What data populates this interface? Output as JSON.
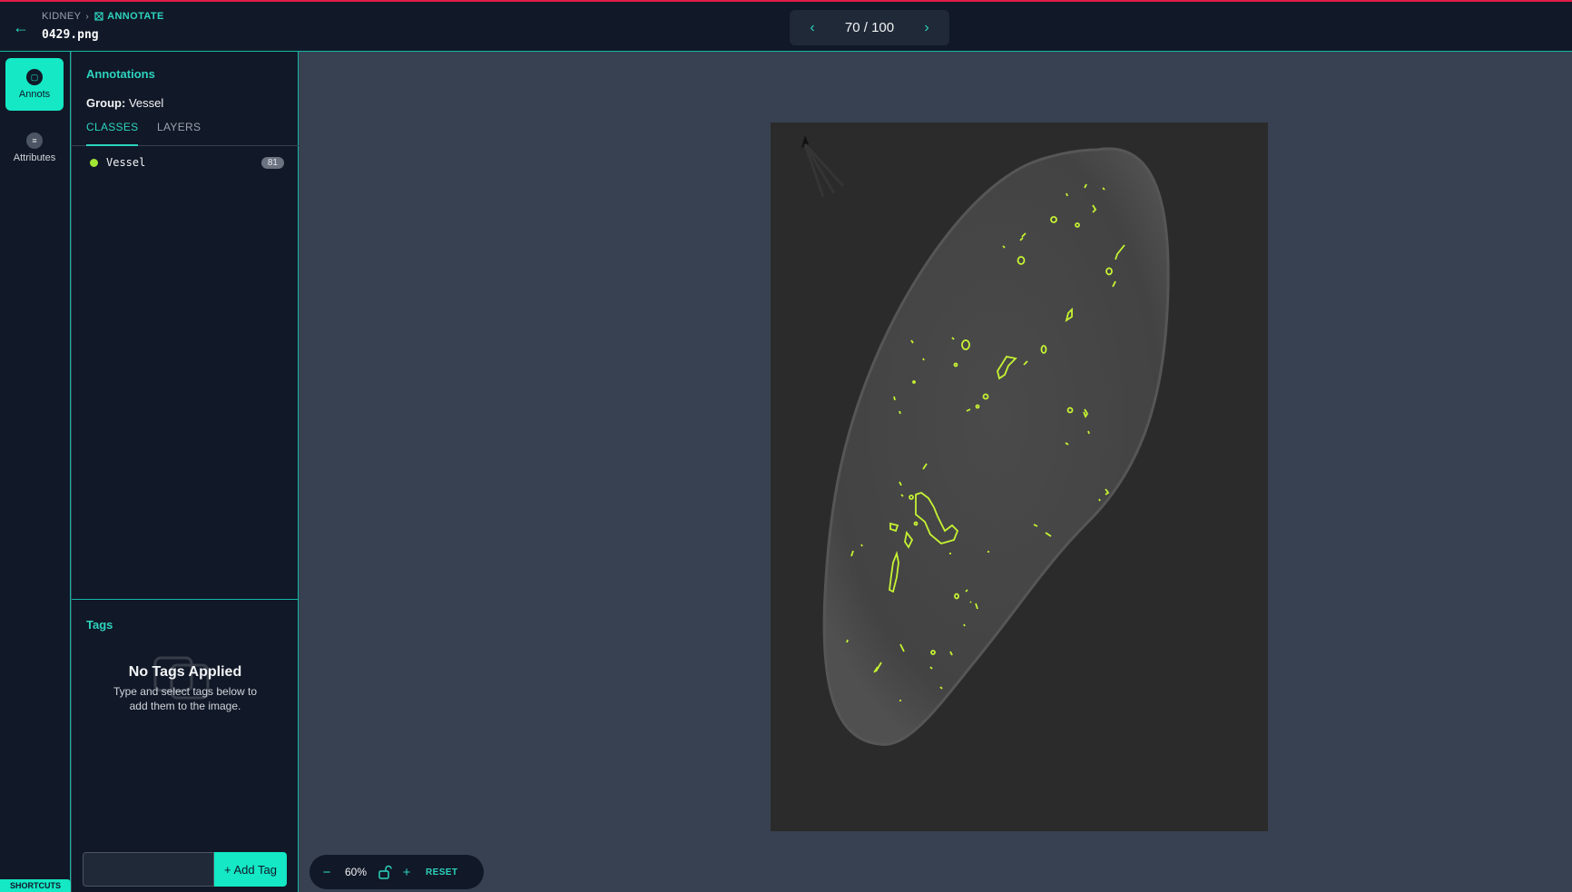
{
  "header": {
    "breadcrumb_root": "KIDNEY",
    "breadcrumb_current": "ANNOTATE",
    "filename": "0429.png",
    "pager_text": "70 / 100"
  },
  "rail": {
    "items": [
      {
        "label": "Annots",
        "icon": "annotation-icon",
        "active": true
      },
      {
        "label": "Attributes",
        "icon": "list-icon",
        "active": false
      }
    ],
    "shortcuts_label": "SHORTCUTS"
  },
  "annotations": {
    "title": "Annotations",
    "group_label": "Group:",
    "group_value": "Vessel",
    "tabs": [
      "CLASSES",
      "LAYERS"
    ],
    "classes": [
      {
        "name": "Vessel",
        "count": "81",
        "color": "#a3e635"
      }
    ]
  },
  "tags": {
    "title": "Tags",
    "empty_title": "No Tags Applied",
    "empty_subtitle": "Type and select tags below to add them to the image.",
    "input_value": "",
    "add_button": "+ Add Tag"
  },
  "zoom": {
    "minus": "−",
    "value": "60%",
    "plus": "+",
    "reset": "RESET"
  },
  "colors": {
    "accent": "#14e8c4",
    "annotation": "#c6f432",
    "alert_line": "#e11d48"
  }
}
